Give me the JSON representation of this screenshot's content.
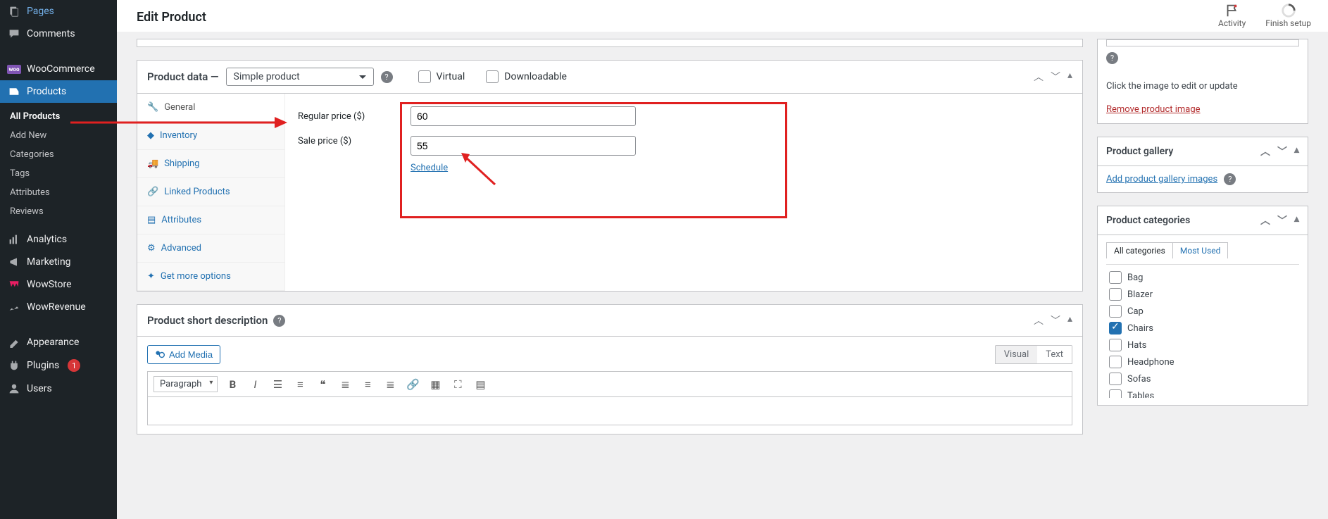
{
  "sidebar": {
    "items": [
      {
        "icon": "pages",
        "label": "Pages"
      },
      {
        "icon": "comment",
        "label": "Comments"
      },
      {
        "icon": "woo",
        "label": "WooCommerce"
      },
      {
        "icon": "products",
        "label": "Products",
        "active": true
      },
      {
        "icon": "analytics",
        "label": "Analytics"
      },
      {
        "icon": "marketing",
        "label": "Marketing"
      },
      {
        "icon": "wowstore",
        "label": "WowStore"
      },
      {
        "icon": "wowrevenue",
        "label": "WowRevenue"
      },
      {
        "icon": "appearance",
        "label": "Appearance"
      },
      {
        "icon": "plugins",
        "label": "Plugins",
        "badge": "1"
      },
      {
        "icon": "users",
        "label": "Users"
      }
    ],
    "submenu": [
      "All Products",
      "Add New",
      "Categories",
      "Tags",
      "Attributes",
      "Reviews"
    ],
    "submenu_active": "All Products"
  },
  "header": {
    "title": "Edit Product",
    "activity": "Activity",
    "finish_setup": "Finish setup"
  },
  "product_data": {
    "title": "Product data —",
    "type": "Simple product",
    "virtual": "Virtual",
    "downloadable": "Downloadable",
    "tabs": [
      "General",
      "Inventory",
      "Shipping",
      "Linked Products",
      "Attributes",
      "Advanced",
      "Get more options"
    ],
    "active_tab": "General",
    "regular_price_label": "Regular price ($)",
    "regular_price_value": "60",
    "sale_price_label": "Sale price ($)",
    "sale_price_value": "55",
    "schedule_link": "Schedule"
  },
  "short_desc": {
    "title": "Product short description",
    "add_media": "Add Media",
    "visual_tab": "Visual",
    "text_tab": "Text",
    "format": "Paragraph"
  },
  "img_panel": {
    "hint": "Click the image to edit or update",
    "remove": "Remove product image"
  },
  "gallery_panel": {
    "title": "Product gallery",
    "add": "Add product gallery images"
  },
  "categories_panel": {
    "title": "Product categories",
    "all_tab": "All categories",
    "used_tab": "Most Used",
    "items": [
      {
        "label": "Bag",
        "checked": false
      },
      {
        "label": "Blazer",
        "checked": false
      },
      {
        "label": "Cap",
        "checked": false
      },
      {
        "label": "Chairs",
        "checked": true
      },
      {
        "label": "Hats",
        "checked": false
      },
      {
        "label": "Headphone",
        "checked": false
      },
      {
        "label": "Sofas",
        "checked": false
      },
      {
        "label": "Tables",
        "checked": false
      }
    ]
  }
}
